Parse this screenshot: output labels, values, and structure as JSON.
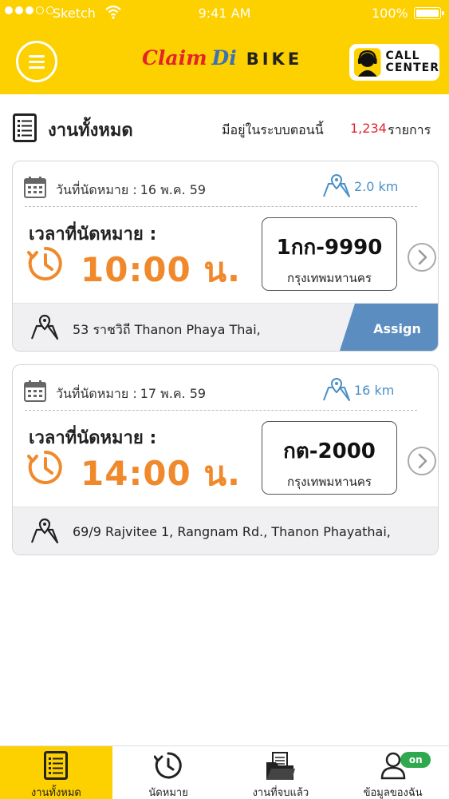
{
  "status_bar": {
    "carrier": "Sketch",
    "time": "9:41 AM",
    "battery": "100%"
  },
  "header": {
    "logo_part1": "Claim",
    "logo_part2": "Di",
    "logo_part3": "BIKE",
    "call_center_line1": "CALL",
    "call_center_line2": "CENTER",
    "brand_color": "#fdd000"
  },
  "title_row": {
    "title": "งานทั้งหมด",
    "count_label": "มีอยู่ในระบบตอนนี้",
    "count": "1,234",
    "count_unit": "รายการ"
  },
  "jobs": [
    {
      "date_label": "วันที่นัดหมาย :",
      "date": "16 พ.ค. 59",
      "distance": "2.0 km",
      "time_label": "เวลาที่นัดหมาย :",
      "time": "10:00 น.",
      "plate_number": "1กก-9990",
      "plate_province": "กรุงเทพมหานคร",
      "address": "53 ราชวิถี Thanon Phaya Thai,",
      "action": "Assign"
    },
    {
      "date_label": "วันที่นัดหมาย :",
      "date": "17 พ.ค. 59",
      "distance": "16 km",
      "time_label": "เวลาที่นัดหมาย :",
      "time": "14:00 น.",
      "plate_number": "กต-2000",
      "plate_province": "กรุงเทพมหานคร",
      "address": "69/9 Rajvitee 1, Rangnam Rd., Thanon Phayathai,"
    }
  ],
  "tabbar": {
    "tabs": [
      {
        "label": "งานทั้งหมด",
        "icon": "list-icon",
        "active": true
      },
      {
        "label": "นัดหมาย",
        "icon": "clock-icon",
        "active": false
      },
      {
        "label": "งานที่จบแล้ว",
        "icon": "folder-icon",
        "active": false
      },
      {
        "label": "ข้อมูลของฉัน",
        "icon": "user-icon",
        "active": false
      }
    ],
    "status_badge": "on"
  }
}
